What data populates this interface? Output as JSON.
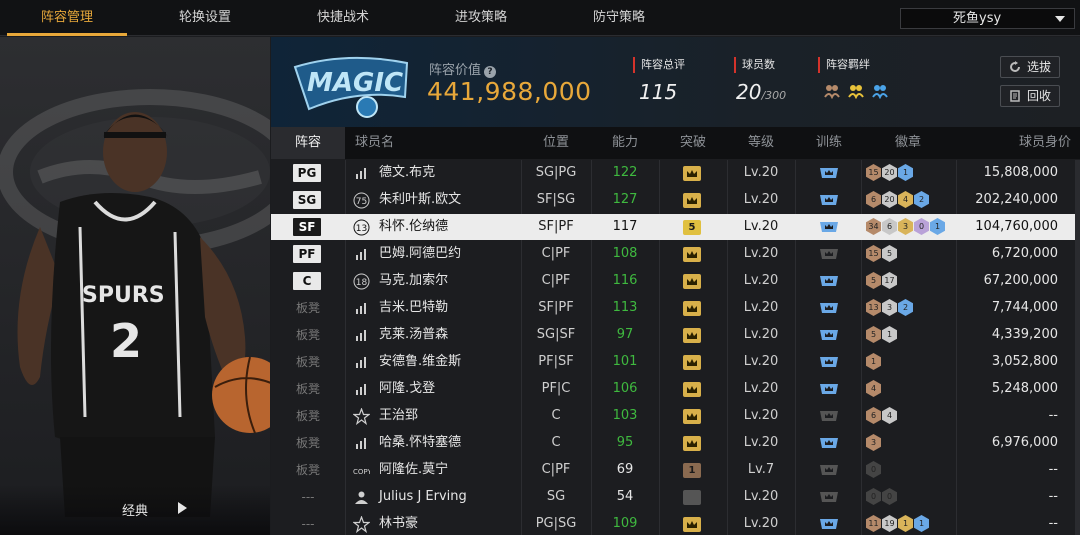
{
  "nav": {
    "tabs": [
      "阵容管理",
      "轮换设置",
      "快捷战术",
      "进攻策略",
      "防守策略"
    ],
    "active_index": 0,
    "account": "死鱼ysy"
  },
  "left": {
    "style_label": "经典"
  },
  "header": {
    "team_logo": "orlando-magic-logo",
    "value_label": "阵容价值",
    "value": "441,988,000",
    "overall_label": "阵容总评",
    "overall": "115",
    "players_label": "球员数",
    "players": "20",
    "players_max": "/300",
    "chem_label": "阵容羁绊",
    "select_button": "选拔",
    "recycle_button": "回收"
  },
  "table": {
    "headers": [
      "阵容",
      "球员名",
      "位置",
      "能力",
      "突破",
      "等级",
      "训练",
      "徽章",
      "球员身价"
    ],
    "rows": [
      {
        "slot": "PG",
        "icon": "stats",
        "name": "德文.布克",
        "pos": "SG|PG",
        "ovr": "122",
        "ovr_color": "green",
        "bt": "crown",
        "lvl": "Lv.20",
        "train": "blue",
        "badges": [
          [
            "15",
            "bronze"
          ],
          [
            "20",
            "silver"
          ],
          [
            "1",
            "blue"
          ]
        ],
        "salary": "15,808,000"
      },
      {
        "slot": "SG",
        "icon": "75",
        "name": "朱利叶斯.欧文",
        "pos": "SF|SG",
        "ovr": "127",
        "ovr_color": "green",
        "bt": "crown",
        "lvl": "Lv.20",
        "train": "blue",
        "badges": [
          [
            "6",
            "bronze"
          ],
          [
            "20",
            "silver"
          ],
          [
            "4",
            "gold"
          ],
          [
            "2",
            "blue"
          ]
        ],
        "salary": "202,240,000"
      },
      {
        "slot": "SF",
        "icon": "13",
        "name": "科怀.伦纳德",
        "pos": "SF|PF",
        "ovr": "117",
        "ovr_color": "white",
        "bt": "5",
        "lvl": "Lv.20",
        "train": "blue",
        "badges": [
          [
            "34",
            "bronze"
          ],
          [
            "6",
            "silver"
          ],
          [
            "3",
            "gold"
          ],
          [
            "0",
            "purple"
          ],
          [
            "1",
            "blue"
          ]
        ],
        "salary": "104,760,000",
        "selected": true
      },
      {
        "slot": "PF",
        "icon": "stats",
        "name": "巴姆.阿德巴约",
        "pos": "C|PF",
        "ovr": "108",
        "ovr_color": "green",
        "bt": "crown",
        "lvl": "Lv.20",
        "train": "grey",
        "badges": [
          [
            "15",
            "bronze"
          ],
          [
            "5",
            "silver"
          ]
        ],
        "salary": "6,720,000"
      },
      {
        "slot": "C",
        "icon": "18",
        "name": "马克.加索尔",
        "pos": "C|PF",
        "ovr": "116",
        "ovr_color": "green",
        "bt": "crown",
        "lvl": "Lv.20",
        "train": "blue",
        "badges": [
          [
            "5",
            "bronze"
          ],
          [
            "17",
            "silver"
          ]
        ],
        "salary": "67,200,000"
      },
      {
        "slot": "板凳",
        "icon": "stats",
        "name": "吉米.巴特勒",
        "pos": "SF|PF",
        "ovr": "113",
        "ovr_color": "green",
        "bt": "crown",
        "lvl": "Lv.20",
        "train": "blue",
        "badges": [
          [
            "13",
            "bronze"
          ],
          [
            "3",
            "silver"
          ],
          [
            "2",
            "blue"
          ]
        ],
        "salary": "7,744,000"
      },
      {
        "slot": "板凳",
        "icon": "stats",
        "name": "克莱.汤普森",
        "pos": "SG|SF",
        "ovr": "97",
        "ovr_color": "green",
        "bt": "crown",
        "lvl": "Lv.20",
        "train": "blue",
        "badges": [
          [
            "5",
            "bronze"
          ],
          [
            "1",
            "silver"
          ]
        ],
        "salary": "4,339,200"
      },
      {
        "slot": "板凳",
        "icon": "stats",
        "name": "安德鲁.维金斯",
        "pos": "PF|SF",
        "ovr": "101",
        "ovr_color": "green",
        "bt": "crown",
        "lvl": "Lv.20",
        "train": "blue",
        "badges": [
          [
            "1",
            "bronze"
          ]
        ],
        "salary": "3,052,800"
      },
      {
        "slot": "板凳",
        "icon": "stats",
        "name": "阿隆.戈登",
        "pos": "PF|C",
        "ovr": "106",
        "ovr_color": "green",
        "bt": "crown",
        "lvl": "Lv.20",
        "train": "blue",
        "badges": [
          [
            "4",
            "bronze"
          ]
        ],
        "salary": "5,248,000"
      },
      {
        "slot": "板凳",
        "icon": "star",
        "name": "王治郅",
        "pos": "C",
        "ovr": "103",
        "ovr_color": "green",
        "bt": "crown",
        "lvl": "Lv.20",
        "train": "grey",
        "badges": [
          [
            "6",
            "bronze"
          ],
          [
            "4",
            "silver"
          ]
        ],
        "salary": "--"
      },
      {
        "slot": "板凳",
        "icon": "stats",
        "name": "哈桑.怀特塞德",
        "pos": "C",
        "ovr": "95",
        "ovr_color": "green",
        "bt": "crown",
        "lvl": "Lv.20",
        "train": "blue",
        "badges": [
          [
            "3",
            "bronze"
          ]
        ],
        "salary": "6,976,000"
      },
      {
        "slot": "板凳",
        "icon": "copy",
        "name": "阿隆佐.莫宁",
        "pos": "C|PF",
        "ovr": "69",
        "ovr_color": "white",
        "bt": "1",
        "lvl": "Lv.7",
        "train": "grey",
        "badges": [
          [
            "0",
            "dark"
          ]
        ],
        "salary": "--"
      },
      {
        "slot": "---",
        "icon": "person",
        "name": "Julius J Erving",
        "pos": "SG",
        "ovr": "54",
        "ovr_color": "white",
        "bt": "none",
        "lvl": "Lv.20",
        "train": "grey",
        "badges": [
          [
            "0",
            "dark"
          ],
          [
            "0",
            "dark"
          ]
        ],
        "salary": "--"
      },
      {
        "slot": "---",
        "icon": "star",
        "name": "林书豪",
        "pos": "PG|SG",
        "ovr": "109",
        "ovr_color": "green",
        "bt": "crown",
        "lvl": "Lv.20",
        "train": "blue",
        "badges": [
          [
            "11",
            "bronze"
          ],
          [
            "19",
            "silver"
          ],
          [
            "1",
            "gold"
          ],
          [
            "1",
            "blue"
          ]
        ],
        "salary": "--"
      }
    ]
  },
  "colors": {
    "accent": "#e8a83a",
    "green": "#3fb93f",
    "stat_red": "#d4332b",
    "badge_bronze": "#b58a6a",
    "badge_silver": "#c8c8c8",
    "badge_gold": "#d9b45a",
    "badge_purple": "#b9a2d8",
    "badge_blue": "#6aa8e6"
  }
}
